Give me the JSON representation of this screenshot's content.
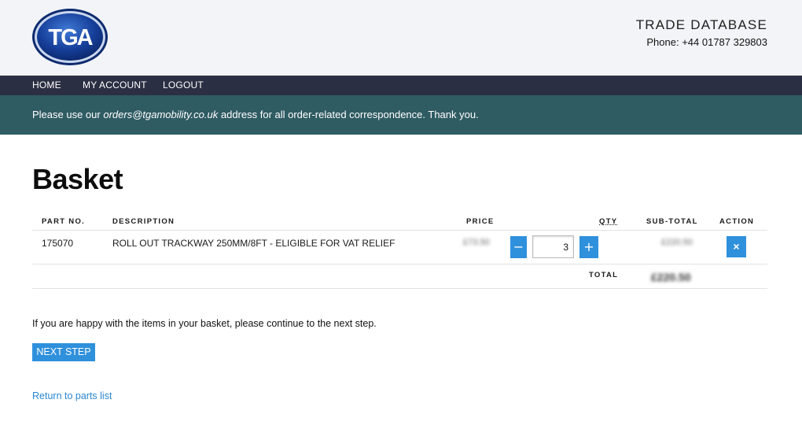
{
  "brand": {
    "logo_text": "TGA"
  },
  "header": {
    "title": "TRADE DATABASE",
    "phone": "Phone: +44 01787 329803"
  },
  "nav": {
    "home": "HOME",
    "account": "MY ACCOUNT",
    "logout": "LOGOUT"
  },
  "notice": {
    "prefix": "Please use our ",
    "email": "orders@tgamobility.co.uk",
    "suffix": " address for all order-related correspondence. Thank you."
  },
  "page": {
    "title": "Basket"
  },
  "table": {
    "headers": {
      "part": "PART NO.",
      "description": "DESCRIPTION",
      "price": "PRICE",
      "qty": "QTY",
      "subtotal": "SUB-TOTAL",
      "action": "ACTION"
    },
    "rows": [
      {
        "part": "175070",
        "description": "ROLL OUT TRACKWAY 250MM/8FT - ELIGIBLE FOR VAT RELIEF",
        "price": "£73.50",
        "qty": "3",
        "subtotal": "£220.50"
      }
    ],
    "total_label": "TOTAL",
    "total_value": "£220.50",
    "minus": "−",
    "plus": "+",
    "remove": "×"
  },
  "footer": {
    "message": "If you are happy with the items in your basket, please continue to the next step.",
    "next_button": "NEXT STEP",
    "return_link": "Return to parts list"
  },
  "colors": {
    "nav_bg": "#2b2f43",
    "notice_bg": "#2f5b63",
    "accent": "#2f90dc",
    "link": "#2a86d2"
  }
}
